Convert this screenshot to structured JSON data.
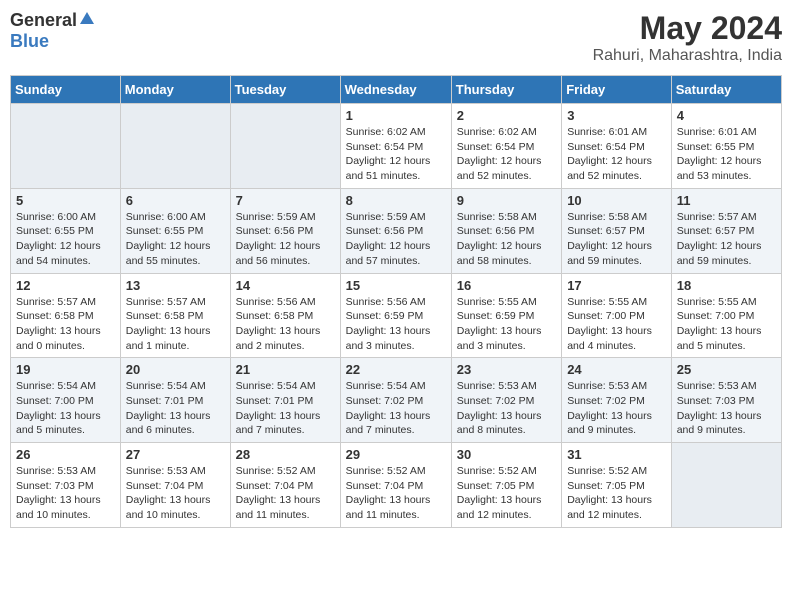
{
  "header": {
    "logo_general": "General",
    "logo_blue": "Blue",
    "title": "May 2024",
    "subtitle": "Rahuri, Maharashtra, India"
  },
  "weekdays": [
    "Sunday",
    "Monday",
    "Tuesday",
    "Wednesday",
    "Thursday",
    "Friday",
    "Saturday"
  ],
  "weeks": [
    [
      {
        "day": "",
        "info": ""
      },
      {
        "day": "",
        "info": ""
      },
      {
        "day": "",
        "info": ""
      },
      {
        "day": "1",
        "info": "Sunrise: 6:02 AM\nSunset: 6:54 PM\nDaylight: 12 hours\nand 51 minutes."
      },
      {
        "day": "2",
        "info": "Sunrise: 6:02 AM\nSunset: 6:54 PM\nDaylight: 12 hours\nand 52 minutes."
      },
      {
        "day": "3",
        "info": "Sunrise: 6:01 AM\nSunset: 6:54 PM\nDaylight: 12 hours\nand 52 minutes."
      },
      {
        "day": "4",
        "info": "Sunrise: 6:01 AM\nSunset: 6:55 PM\nDaylight: 12 hours\nand 53 minutes."
      }
    ],
    [
      {
        "day": "5",
        "info": "Sunrise: 6:00 AM\nSunset: 6:55 PM\nDaylight: 12 hours\nand 54 minutes."
      },
      {
        "day": "6",
        "info": "Sunrise: 6:00 AM\nSunset: 6:55 PM\nDaylight: 12 hours\nand 55 minutes."
      },
      {
        "day": "7",
        "info": "Sunrise: 5:59 AM\nSunset: 6:56 PM\nDaylight: 12 hours\nand 56 minutes."
      },
      {
        "day": "8",
        "info": "Sunrise: 5:59 AM\nSunset: 6:56 PM\nDaylight: 12 hours\nand 57 minutes."
      },
      {
        "day": "9",
        "info": "Sunrise: 5:58 AM\nSunset: 6:56 PM\nDaylight: 12 hours\nand 58 minutes."
      },
      {
        "day": "10",
        "info": "Sunrise: 5:58 AM\nSunset: 6:57 PM\nDaylight: 12 hours\nand 59 minutes."
      },
      {
        "day": "11",
        "info": "Sunrise: 5:57 AM\nSunset: 6:57 PM\nDaylight: 12 hours\nand 59 minutes."
      }
    ],
    [
      {
        "day": "12",
        "info": "Sunrise: 5:57 AM\nSunset: 6:58 PM\nDaylight: 13 hours\nand 0 minutes."
      },
      {
        "day": "13",
        "info": "Sunrise: 5:57 AM\nSunset: 6:58 PM\nDaylight: 13 hours\nand 1 minute."
      },
      {
        "day": "14",
        "info": "Sunrise: 5:56 AM\nSunset: 6:58 PM\nDaylight: 13 hours\nand 2 minutes."
      },
      {
        "day": "15",
        "info": "Sunrise: 5:56 AM\nSunset: 6:59 PM\nDaylight: 13 hours\nand 3 minutes."
      },
      {
        "day": "16",
        "info": "Sunrise: 5:55 AM\nSunset: 6:59 PM\nDaylight: 13 hours\nand 3 minutes."
      },
      {
        "day": "17",
        "info": "Sunrise: 5:55 AM\nSunset: 7:00 PM\nDaylight: 13 hours\nand 4 minutes."
      },
      {
        "day": "18",
        "info": "Sunrise: 5:55 AM\nSunset: 7:00 PM\nDaylight: 13 hours\nand 5 minutes."
      }
    ],
    [
      {
        "day": "19",
        "info": "Sunrise: 5:54 AM\nSunset: 7:00 PM\nDaylight: 13 hours\nand 5 minutes."
      },
      {
        "day": "20",
        "info": "Sunrise: 5:54 AM\nSunset: 7:01 PM\nDaylight: 13 hours\nand 6 minutes."
      },
      {
        "day": "21",
        "info": "Sunrise: 5:54 AM\nSunset: 7:01 PM\nDaylight: 13 hours\nand 7 minutes."
      },
      {
        "day": "22",
        "info": "Sunrise: 5:54 AM\nSunset: 7:02 PM\nDaylight: 13 hours\nand 7 minutes."
      },
      {
        "day": "23",
        "info": "Sunrise: 5:53 AM\nSunset: 7:02 PM\nDaylight: 13 hours\nand 8 minutes."
      },
      {
        "day": "24",
        "info": "Sunrise: 5:53 AM\nSunset: 7:02 PM\nDaylight: 13 hours\nand 9 minutes."
      },
      {
        "day": "25",
        "info": "Sunrise: 5:53 AM\nSunset: 7:03 PM\nDaylight: 13 hours\nand 9 minutes."
      }
    ],
    [
      {
        "day": "26",
        "info": "Sunrise: 5:53 AM\nSunset: 7:03 PM\nDaylight: 13 hours\nand 10 minutes."
      },
      {
        "day": "27",
        "info": "Sunrise: 5:53 AM\nSunset: 7:04 PM\nDaylight: 13 hours\nand 10 minutes."
      },
      {
        "day": "28",
        "info": "Sunrise: 5:52 AM\nSunset: 7:04 PM\nDaylight: 13 hours\nand 11 minutes."
      },
      {
        "day": "29",
        "info": "Sunrise: 5:52 AM\nSunset: 7:04 PM\nDaylight: 13 hours\nand 11 minutes."
      },
      {
        "day": "30",
        "info": "Sunrise: 5:52 AM\nSunset: 7:05 PM\nDaylight: 13 hours\nand 12 minutes."
      },
      {
        "day": "31",
        "info": "Sunrise: 5:52 AM\nSunset: 7:05 PM\nDaylight: 13 hours\nand 12 minutes."
      },
      {
        "day": "",
        "info": ""
      }
    ]
  ]
}
